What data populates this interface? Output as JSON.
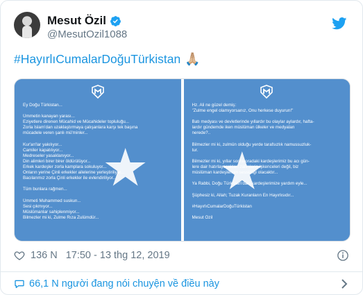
{
  "author": {
    "display_name": "Mesut Özil",
    "handle": "@MesutOzil1088",
    "verified": true,
    "avatar_icon": "avatar-photo"
  },
  "tweet": {
    "hashtag": "#HayırlıCumalarDoğuTürkistan",
    "emoji": "🙏🏼"
  },
  "media": {
    "panel_left": [
      "Ey Doğu Türkistan...",
      "",
      "Ümmetin kanayan yarası...",
      "Eziyetlere direnen Mücahid ve Mücahideler topluluğu...",
      "Zorla İslam'dan uzaklaştırmaya çalışanlara karşı tek başına",
      "mücadele veren şanlı mü'minler...",
      "",
      "Kur'an'lar yakılıyor...",
      "Camiler kapatılıyor...",
      "Medreseler yasaklanıyor...",
      "Din alimleri birer birer öldürülüyor...",
      "Erkek kardeşler zorla kamplara sokuluyor...",
      "Onların yerine Çinli erkekler ailelerine yerleştiriliyor...",
      "Bacılarımız zorla Çinli erkekler ile evlendiriliyor...",
      "",
      "Tüm bunlara rağmen...",
      "",
      "Ümmeti Muhammed suskun...",
      "Sesi çıkmıyor...",
      "Müslümanlar sahiplenmiyor...",
      "Bilmezler mi ki, Zulme Rıza Zulümdür..."
    ],
    "panel_right": [
      "Hz. Ali ne güzel demiş:",
      "\"Zulme engel olamıyorsanız, Onu herkese duyurun!\"",
      "",
      "Batı medyası ve devletlerinde yıllardır bu olaylar aylardır, hafta-",
      "lardır gündemde iken müslüman ülkeler ve medyaları",
      "nerede?..",
      "",
      "Bilmezler mi ki, zulmün olduğu yerde tarafsızlık namussuzluk-",
      "tur.",
      "",
      "Bilmezler mi ki, yıllar sonra oradaki kardeşlerimiz bu acı gün-",
      "lere dair hatırlayacakları zalimlerin işkenceleri değil, biz",
      "müslüman kardeşlerinin sessizliği olacaktır...",
      "",
      "Ya Rabbi, Doğu Türkistan'daki kardeşlerimize yardım eyle...",
      "",
      "Şüphesiz ki, Allah; Tuzak Kuranların En Hayırlısıdır...",
      "",
      "#HayırlıCumalarDoğuTürkistan",
      "",
      "Mesut Özil"
    ],
    "flag_color": "#5a95d1",
    "emblem_color": "#ffffff"
  },
  "meta": {
    "likes": "136 N",
    "timestamp": "17:50 - 13 thg 12, 2019"
  },
  "footer": {
    "conversation": "66,1 N người đang nói chuyện về điều này"
  },
  "colors": {
    "link": "#1b95e0",
    "muted": "#657786",
    "twitter_blue": "#1da1f2",
    "border": "#e1e8ed"
  }
}
